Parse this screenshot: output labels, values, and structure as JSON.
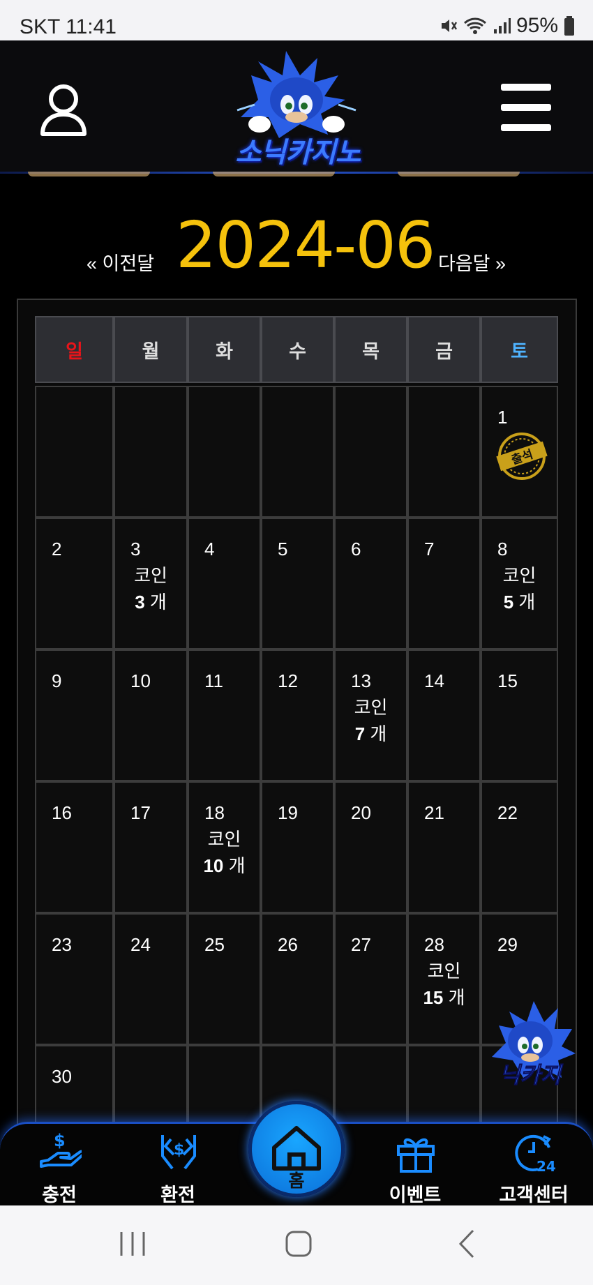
{
  "status_bar": {
    "carrier_time": "SKT 11:41",
    "battery": "95%"
  },
  "header": {
    "logo_text": "소닉카지노"
  },
  "month_nav": {
    "prev_label": "« 이전달",
    "title": "2024-06",
    "next_label": "다음달 »"
  },
  "calendar": {
    "weekdays": [
      "일",
      "월",
      "화",
      "수",
      "목",
      "금",
      "토"
    ],
    "weekday_colors": [
      "#e8141a",
      "#dddddd",
      "#dddddd",
      "#dddddd",
      "#dddddd",
      "#dddddd",
      "#4fb3ff"
    ],
    "weeks": [
      [
        {
          "day": ""
        },
        {
          "day": ""
        },
        {
          "day": ""
        },
        {
          "day": ""
        },
        {
          "day": ""
        },
        {
          "day": ""
        },
        {
          "day": "1",
          "stamp": "출석"
        }
      ],
      [
        {
          "day": "2"
        },
        {
          "day": "3",
          "coin_label": "코인",
          "coin_count": "3",
          "coin_unit": " 개"
        },
        {
          "day": "4"
        },
        {
          "day": "5"
        },
        {
          "day": "6"
        },
        {
          "day": "7"
        },
        {
          "day": "8",
          "coin_label": "코인",
          "coin_count": "5",
          "coin_unit": " 개"
        }
      ],
      [
        {
          "day": "9"
        },
        {
          "day": "10"
        },
        {
          "day": "11"
        },
        {
          "day": "12"
        },
        {
          "day": "13",
          "coin_label": "코인",
          "coin_count": "7",
          "coin_unit": " 개"
        },
        {
          "day": "14"
        },
        {
          "day": "15"
        }
      ],
      [
        {
          "day": "16"
        },
        {
          "day": "17"
        },
        {
          "day": "18",
          "coin_label": "코인",
          "coin_count": "10",
          "coin_unit": " 개"
        },
        {
          "day": "19"
        },
        {
          "day": "20"
        },
        {
          "day": "21"
        },
        {
          "day": "22"
        }
      ],
      [
        {
          "day": "23"
        },
        {
          "day": "24"
        },
        {
          "day": "25"
        },
        {
          "day": "26"
        },
        {
          "day": "27"
        },
        {
          "day": "28",
          "coin_label": "코인",
          "coin_count": "15",
          "coin_unit": " 개"
        },
        {
          "day": "29"
        }
      ],
      [
        {
          "day": "30"
        },
        {
          "day": ""
        },
        {
          "day": ""
        },
        {
          "day": ""
        },
        {
          "day": ""
        },
        {
          "day": ""
        },
        {
          "day": ""
        }
      ]
    ]
  },
  "bottom_nav": {
    "items": [
      {
        "label": "충전",
        "icon": "deposit-icon"
      },
      {
        "label": "환전",
        "icon": "exchange-icon"
      },
      {
        "label": "홈",
        "icon": "home-icon"
      },
      {
        "label": "이벤트",
        "icon": "gift-icon"
      },
      {
        "label": "고객센터",
        "icon": "support-24-icon"
      }
    ]
  },
  "colors": {
    "accent_gold": "#f5c20c",
    "accent_blue": "#1a8cff"
  }
}
